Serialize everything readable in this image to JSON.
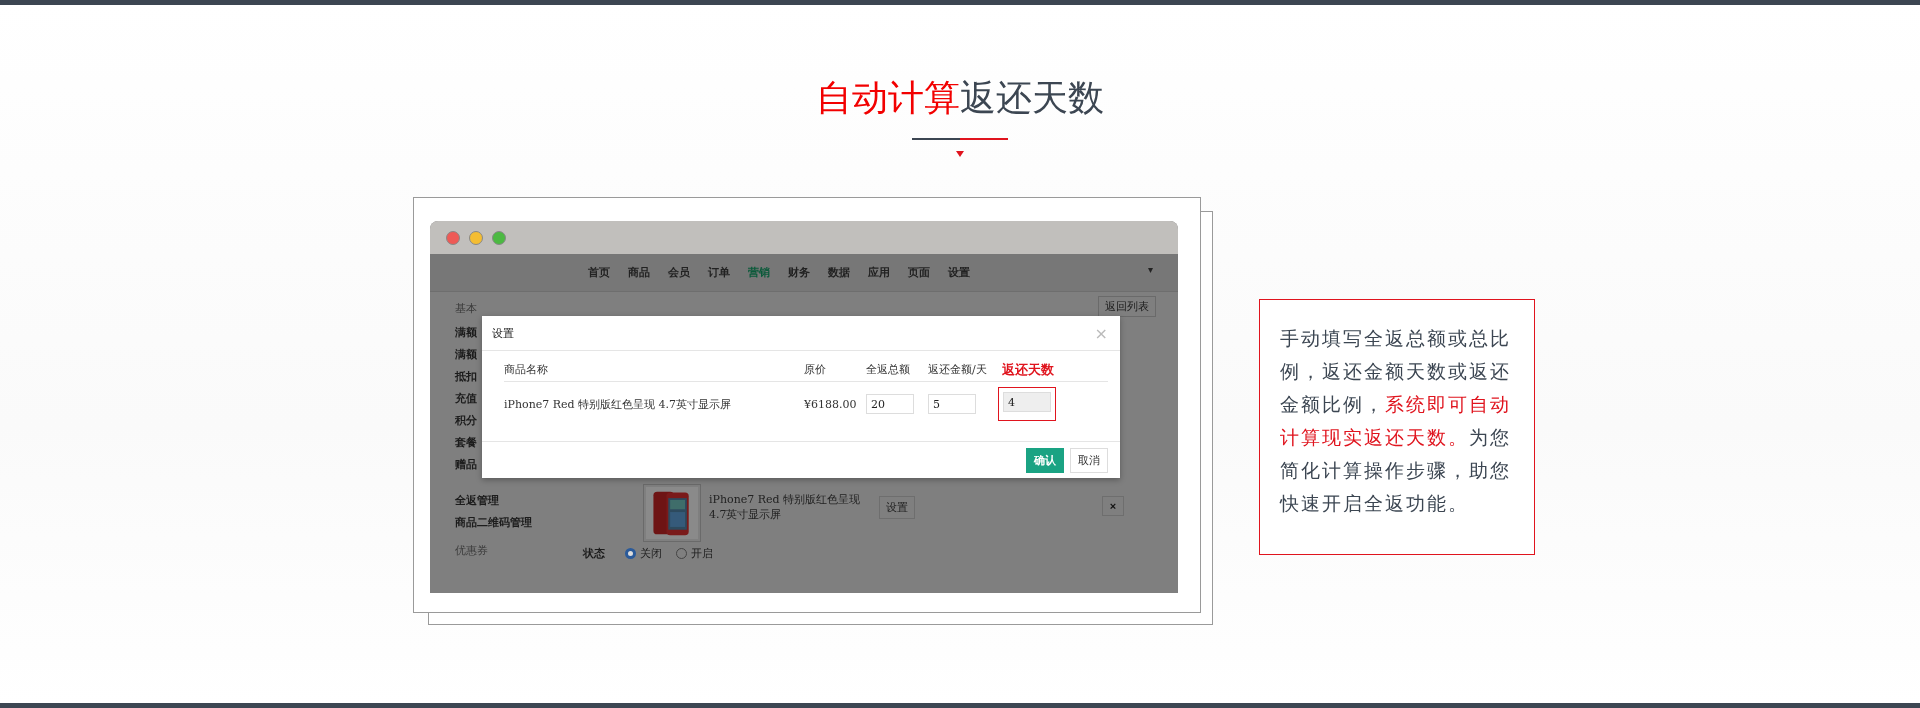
{
  "heading": {
    "segments": [
      {
        "text": "自动计算",
        "highlight": true
      },
      {
        "text": "返还天数",
        "highlight": false
      }
    ]
  },
  "app": {
    "nav": [
      {
        "label": "首页",
        "selected": false
      },
      {
        "label": "商品",
        "selected": false
      },
      {
        "label": "会员",
        "selected": false
      },
      {
        "label": "订单",
        "selected": false
      },
      {
        "label": "营销",
        "selected": true
      },
      {
        "label": "财务",
        "selected": false
      },
      {
        "label": "数据",
        "selected": false
      },
      {
        "label": "应用",
        "selected": false
      },
      {
        "label": "页面",
        "selected": false
      },
      {
        "label": "设置",
        "selected": false
      }
    ],
    "nav_caret": "▾",
    "sidebar": [
      {
        "label": "基本",
        "kind": "group"
      },
      {
        "label": "满额",
        "kind": "item"
      },
      {
        "label": "满额",
        "kind": "item"
      },
      {
        "label": "抵扣",
        "kind": "item"
      },
      {
        "label": "充值",
        "kind": "item"
      },
      {
        "label": "积分",
        "kind": "item"
      },
      {
        "label": "套餐",
        "kind": "item"
      },
      {
        "label": "赠品",
        "kind": "item"
      },
      {
        "label": "全返管理",
        "kind": "item"
      },
      {
        "label": "商品二维码管理",
        "kind": "item"
      },
      {
        "label": "优惠券",
        "kind": "group"
      }
    ],
    "back_button": "返回列表",
    "product": {
      "name": "iPhone7 Red 特别版红色呈现 4.7英寸显示屏",
      "settings_button": "设置",
      "remove_button": "×"
    },
    "status": {
      "label": "状态",
      "options": [
        {
          "label": "关闭",
          "selected": true
        },
        {
          "label": "开启",
          "selected": false
        }
      ]
    }
  },
  "dialog": {
    "title": "设置",
    "close": "×",
    "columns": [
      {
        "label": "商品名称",
        "highlight": false
      },
      {
        "label": "原价",
        "highlight": false
      },
      {
        "label": "全返总额",
        "highlight": false
      },
      {
        "label": "返还金额/天",
        "highlight": false
      },
      {
        "label": "返还天数",
        "highlight": true
      }
    ],
    "row": {
      "name": "iPhone7 Red 特别版红色呈现 4.7英寸显示屏",
      "price": "¥6188.00",
      "total": "20",
      "per_day": "5",
      "days": "4"
    },
    "confirm": "确认",
    "cancel": "取消"
  },
  "note": {
    "segments": [
      {
        "text": "手动填写全返总额或总比例，返还金额天数或返还金额比例，",
        "highlight": false
      },
      {
        "text": "系统即可自动计算现实返还天数。",
        "highlight": true
      },
      {
        "text": "为您简化计算操作步骤，助您快速开启全返功能。",
        "highlight": false
      }
    ]
  }
}
